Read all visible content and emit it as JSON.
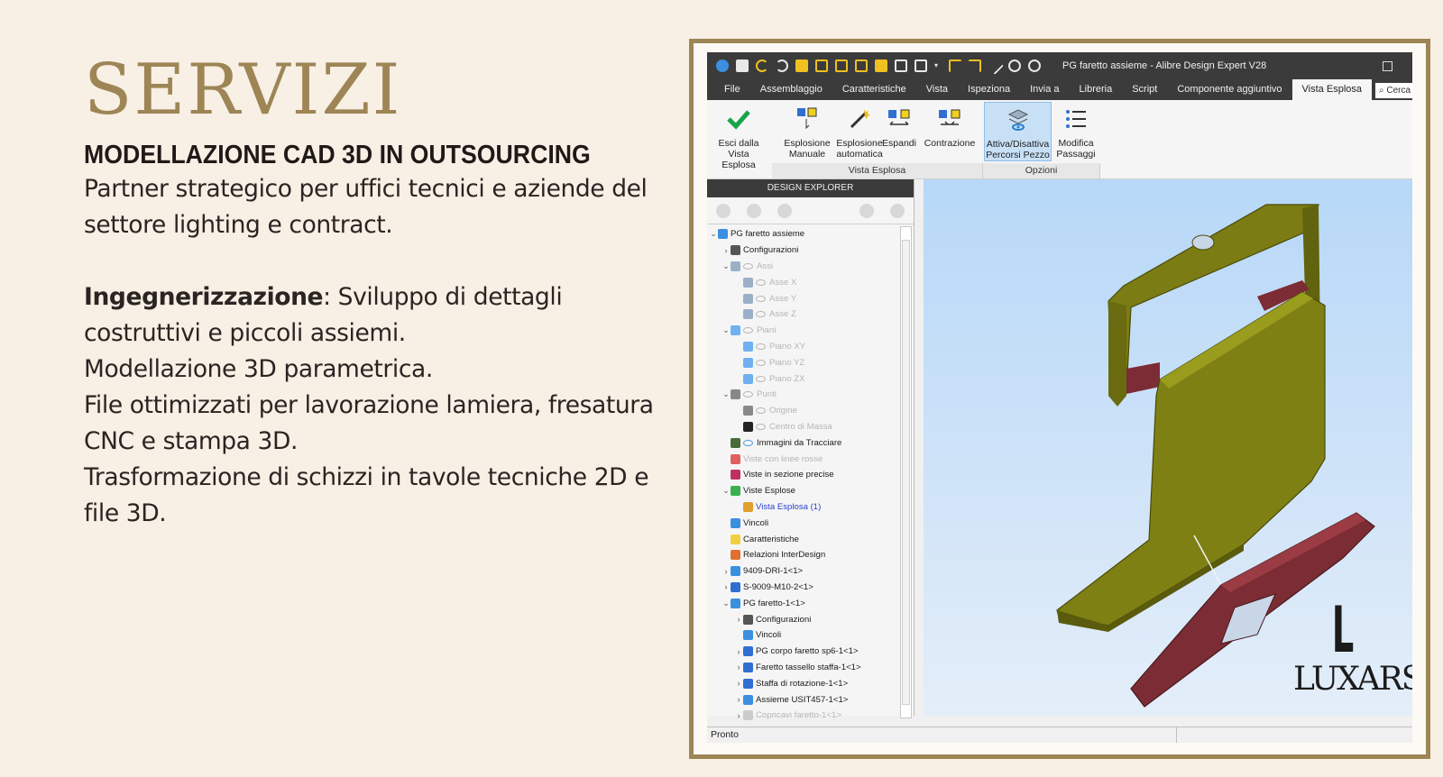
{
  "slide": {
    "title": "SERVIZI",
    "subtitle": "MODELLAZIONE CAD 3D IN OUTSOURCING",
    "intro": "Partner strategico per uffici tecnici e aziende del settore lighting e contract.",
    "engineering_label": "Ingegnerizzazione",
    "engineering_text": ": Sviluppo di dettagli costruttivi e piccoli assiemi.",
    "line_modeling": "Modellazione 3D parametrica.",
    "line_files": "File ottimizzati per lavorazione lamiera, fresatura CNC e stampa 3D.",
    "line_transform": "Trasformazione di schizzi in tavole tecniche 2D e file 3D."
  },
  "app": {
    "title": "PG faretto assieme - Alibre Design Expert V28",
    "menu": [
      "File",
      "Assemblaggio",
      "Caratteristiche",
      "Vista",
      "Ispeziona",
      "Invia a",
      "Libreria",
      "Script",
      "Componente aggiuntivo",
      "Vista Esplosa"
    ],
    "search_placeholder": "Cerca",
    "ribbon": {
      "exit": "Esci dalla Vista Esplosa",
      "manual": "Esplosione Manuale",
      "auto": "Esplosione automatica",
      "expand": "Espandi",
      "contract": "Contrazione",
      "toggle_paths": "Attiva/Disattiva Percorsi Pezzo",
      "edit_steps": "Modifica Passaggi",
      "group_exploded": "Vista Esplosa",
      "group_options": "Opzioni"
    },
    "explorer_title": "DESIGN EXPLORER",
    "tree": [
      {
        "label": "PG faretto assieme",
        "level": 0,
        "toggle": "v",
        "icon": "#3c8fe0",
        "eye": false,
        "state": "normal"
      },
      {
        "label": "Configurazioni",
        "level": 1,
        "toggle": ">",
        "icon": "#555555",
        "eye": false,
        "state": "normal"
      },
      {
        "label": "Assi",
        "level": 1,
        "toggle": "v",
        "icon": "#9ab0c8",
        "eye": true,
        "state": "dim"
      },
      {
        "label": "Asse X",
        "level": 2,
        "toggle": "",
        "icon": "#9ab0c8",
        "eye": true,
        "state": "dim"
      },
      {
        "label": "Asse Y",
        "level": 2,
        "toggle": "",
        "icon": "#9ab0c8",
        "eye": true,
        "state": "dim"
      },
      {
        "label": "Asse Z",
        "level": 2,
        "toggle": "",
        "icon": "#9ab0c8",
        "eye": true,
        "state": "dim"
      },
      {
        "label": "Piani",
        "level": 1,
        "toggle": "v",
        "icon": "#6fb0f0",
        "eye": true,
        "state": "dim"
      },
      {
        "label": "Piano XY",
        "level": 2,
        "toggle": "",
        "icon": "#6fb0f0",
        "eye": true,
        "state": "dim"
      },
      {
        "label": "Piano YZ",
        "level": 2,
        "toggle": "",
        "icon": "#6fb0f0",
        "eye": true,
        "state": "dim"
      },
      {
        "label": "Piano ZX",
        "level": 2,
        "toggle": "",
        "icon": "#6fb0f0",
        "eye": true,
        "state": "dim"
      },
      {
        "label": "Punti",
        "level": 1,
        "toggle": "v",
        "icon": "#888888",
        "eye": true,
        "state": "dim"
      },
      {
        "label": "Origine",
        "level": 2,
        "toggle": "",
        "icon": "#888888",
        "eye": true,
        "state": "dim"
      },
      {
        "label": "Centro di Massa",
        "level": 2,
        "toggle": "",
        "icon": "#222222",
        "eye": true,
        "state": "dim"
      },
      {
        "label": "Immagini da Tracciare",
        "level": 1,
        "toggle": "",
        "icon": "#4a6a3a",
        "eye": true,
        "state": "normal"
      },
      {
        "label": "Viste con linee rosse",
        "level": 1,
        "toggle": "",
        "icon": "#e06060",
        "eye": false,
        "state": "dim"
      },
      {
        "label": "Viste in sezione precise",
        "level": 1,
        "toggle": "",
        "icon": "#c03060",
        "eye": false,
        "state": "normal"
      },
      {
        "label": "Viste Esplose",
        "level": 1,
        "toggle": "v",
        "icon": "#3cb050",
        "eye": false,
        "state": "normal"
      },
      {
        "label": "Vista Esplosa (1)",
        "level": 2,
        "toggle": "",
        "icon": "#e0a030",
        "eye": false,
        "state": "sel"
      },
      {
        "label": "Vincoli",
        "level": 1,
        "toggle": "",
        "icon": "#3c8fe0",
        "eye": false,
        "state": "normal"
      },
      {
        "label": "Caratteristiche",
        "level": 1,
        "toggle": "",
        "icon": "#f0d040",
        "eye": false,
        "state": "normal"
      },
      {
        "label": "Relazioni InterDesign",
        "level": 1,
        "toggle": "",
        "icon": "#e07030",
        "eye": false,
        "state": "normal"
      },
      {
        "label": "9409-DRI-1<1>",
        "level": 1,
        "toggle": ">",
        "icon": "#3c8fe0",
        "eye": false,
        "state": "normal"
      },
      {
        "label": "S-9009-M10-2<1>",
        "level": 1,
        "toggle": ">",
        "icon": "#2f6fd0",
        "eye": false,
        "state": "normal"
      },
      {
        "label": "PG faretto-1<1>",
        "level": 1,
        "toggle": "v",
        "icon": "#3c8fe0",
        "eye": false,
        "state": "normal"
      },
      {
        "label": "Configurazioni",
        "level": 2,
        "toggle": ">",
        "icon": "#555555",
        "eye": false,
        "state": "normal"
      },
      {
        "label": "Vincoli",
        "level": 2,
        "toggle": "",
        "icon": "#3c8fe0",
        "eye": false,
        "state": "normal"
      },
      {
        "label": "PG corpo faretto sp6-1<1>",
        "level": 2,
        "toggle": ">",
        "icon": "#2f6fd0",
        "eye": false,
        "state": "normal"
      },
      {
        "label": "Faretto tassello staffa-1<1>",
        "level": 2,
        "toggle": ">",
        "icon": "#2f6fd0",
        "eye": false,
        "state": "normal"
      },
      {
        "label": "Staffa di rotazione-1<1>",
        "level": 2,
        "toggle": ">",
        "icon": "#2f6fd0",
        "eye": false,
        "state": "normal"
      },
      {
        "label": "Assieme USIT457-1<1>",
        "level": 2,
        "toggle": ">",
        "icon": "#3c8fe0",
        "eye": false,
        "state": "normal"
      },
      {
        "label": "Copricavi faretto-1<1>",
        "level": 2,
        "toggle": ">",
        "icon": "#cccccc",
        "eye": false,
        "state": "dim"
      }
    ],
    "status": "Pronto"
  },
  "logo": {
    "mark": "L",
    "text": "LUXARS"
  },
  "colors": {
    "accent": "#9d8555",
    "background": "#f8efe5",
    "part_green": "#7a7a10",
    "part_red": "#7a2e35"
  }
}
